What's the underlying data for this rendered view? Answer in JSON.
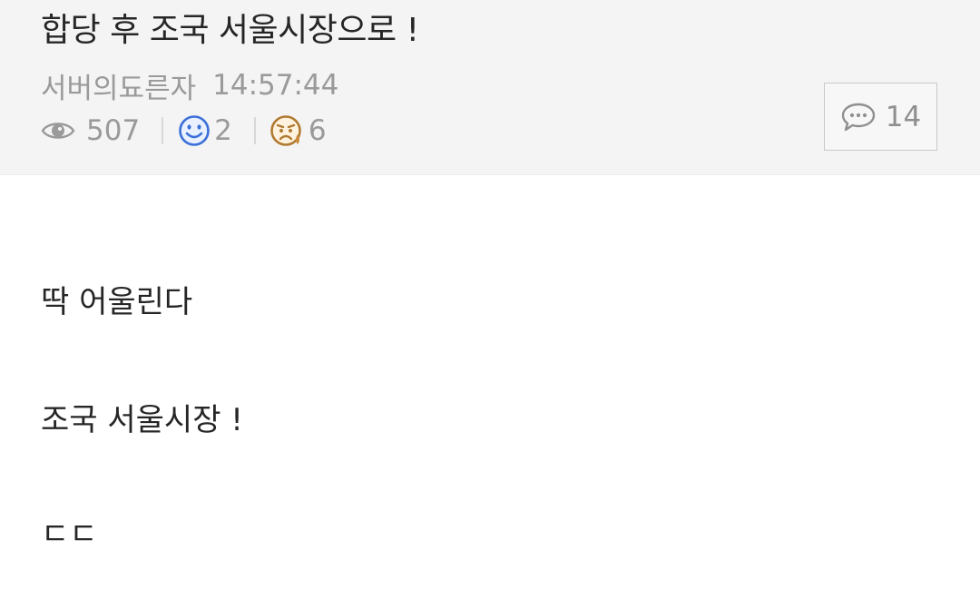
{
  "post": {
    "title": "합당 후 조국 서울시장으로 !",
    "author": "서버의됴른자",
    "time": "14:57:44",
    "views": "507",
    "likes": "2",
    "dislikes": "6",
    "comments": "14"
  },
  "icons": {
    "views": "eye-icon",
    "likes": "smiley-face-icon",
    "dislikes": "sad-face-icon",
    "comments": "speech-bubble-icon"
  },
  "colors": {
    "header_bg": "#f4f4f4",
    "like_blue": "#3b6fd8",
    "dislike_brown": "#b07a30"
  },
  "content": {
    "lines": [
      "딱 어울린다",
      "조국 서울시장 !",
      "ㄷㄷ"
    ]
  }
}
